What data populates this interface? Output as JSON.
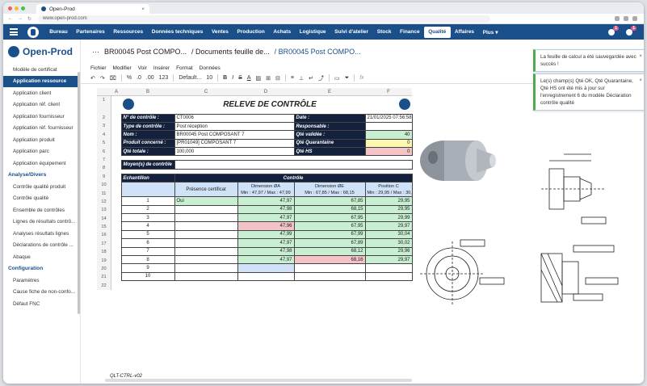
{
  "browser": {
    "tab_title": "Open-Prod",
    "url": "www.open-prod.com"
  },
  "menu": {
    "items": [
      "Bureau",
      "Partenaires",
      "Ressources",
      "Données techniques",
      "Ventes",
      "Production",
      "Achats",
      "Logistique",
      "Suivi d'atelier",
      "Stock",
      "Finance",
      "Qualité",
      "Affaires",
      "Plus ▾"
    ],
    "active": "Qualité",
    "badge1": "1",
    "badge2": "1"
  },
  "sidebar": {
    "brand": "Open-Prod",
    "items_top": [
      "Modèle de certificat",
      "Application ressource",
      "Application client",
      "Application réf. client",
      "Application fournisseur",
      "Application réf. fournisseur",
      "Application produit",
      "Application parc",
      "Application équipement"
    ],
    "selected": "Application ressource",
    "section2": "Analyse/Divers",
    "items2": [
      "Contrôle qualité produit",
      "Contrôle qualité",
      "Ensemble de contrôles",
      "Lignes de résultats contrô...",
      "Analyses résultats lignes",
      "Déclarations de contrôle ...",
      "Abaque"
    ],
    "section3": "Configuration",
    "items3": [
      "Paramètres",
      "Cause fiche de non-confo...",
      "Défaut FNC"
    ]
  },
  "breadcrumb": {
    "ellipsis": "···",
    "c1": "BR00045 Post COMPO...",
    "c2": "/ Documents feuille de...",
    "c3": "/ BR00045 Post COMPO..."
  },
  "sheet_menu": [
    "Fichier",
    "Modifier",
    "Voir",
    "Insérer",
    "Format",
    "Données"
  ],
  "toolbar": {
    "zoom": "%",
    "decimal": ".0",
    "decimal2": ".00",
    "numfmt": "123",
    "font": "Default...",
    "size": "10",
    "fx": "fx"
  },
  "columns": [
    "A",
    "B",
    "C",
    "D",
    "E",
    "F"
  ],
  "rows": [
    "1",
    "2",
    "3",
    "4",
    "5",
    "6",
    "7",
    "8",
    "9",
    "10",
    "11",
    "12",
    "13",
    "14",
    "15",
    "16",
    "17",
    "18",
    "19",
    "20",
    "21",
    "22"
  ],
  "sheet": {
    "title": "RELEVE DE CONTRÔLE",
    "n_controle_l": "N° de contrôle :",
    "n_controle": "CT0006",
    "date_l": "Date :",
    "date": "21/01/2025 07:56:58",
    "type_l": "Type de contrôle :",
    "type": "Post réception",
    "resp_l": "Responsable :",
    "nom_l": "Nom :",
    "nom": "BR00045 Post COMPOSANT 7",
    "qv_l": "Qté validée :",
    "qv": "40",
    "prod_l": "Produit concerné :",
    "prod": "[PR01049] COMPOSANT 7",
    "qq_l": "Qté Quarantaine",
    "qq": "0",
    "qt_l": "Qté totale :",
    "qt": "100,000",
    "qhs_l": "Qté HS",
    "qhs": "0",
    "moyen_l": "Moyen(s) de contrôle",
    "echant": "Echantillon",
    "controle": "Contrôle",
    "presence": "Présence certificat",
    "dimA": "Dimension ØA",
    "dimA_r": "Min : 47,97 / Max : 47,99",
    "dimE": "Dimension ØE",
    "dimE_r": "Min : 67,85 / Max : 68,15",
    "posC": "Position C",
    "posC_r": "Min : 29,95 / Max : 30,05",
    "samples": [
      {
        "n": "1",
        "p": "Oui",
        "a": "47,97",
        "e": "67,85",
        "c": "29,95"
      },
      {
        "n": "2",
        "p": "",
        "a": "47,98",
        "e": "68,15",
        "c": "29,95"
      },
      {
        "n": "3",
        "p": "",
        "a": "47,97",
        "e": "67,95",
        "c": "29,99"
      },
      {
        "n": "4",
        "p": "",
        "a": "47,96",
        "e": "67,95",
        "c": "29,97"
      },
      {
        "n": "5",
        "p": "",
        "a": "47,99",
        "e": "67,99",
        "c": "30,04"
      },
      {
        "n": "6",
        "p": "",
        "a": "47,97",
        "e": "67,89",
        "c": "30,02"
      },
      {
        "n": "7",
        "p": "",
        "a": "47,98",
        "e": "68,12",
        "c": "29,96"
      },
      {
        "n": "8",
        "p": "",
        "a": "47,97",
        "e": "68,16",
        "c": "29,97"
      },
      {
        "n": "9",
        "p": "",
        "a": "",
        "e": "",
        "c": ""
      },
      {
        "n": "10",
        "p": "",
        "a": "",
        "e": "",
        "c": ""
      }
    ],
    "footer": "QLT-CTRL-v02"
  },
  "toasts": [
    {
      "text": "La feuille de calcul a été sauvegardée avec succès !"
    },
    {
      "text": "Le(s) champ(s) Qté OK, Qté Quarantaine, Qté HS ont été mis à jour sur l'enregistrement 6 du modèle Déclaration contrôle qualité"
    }
  ],
  "colors": {
    "nav": "#1b4f8a",
    "green": "#c9efd2",
    "yellow": "#fdf8b0",
    "pink": "#f4c3c7",
    "header": "#14213d"
  }
}
